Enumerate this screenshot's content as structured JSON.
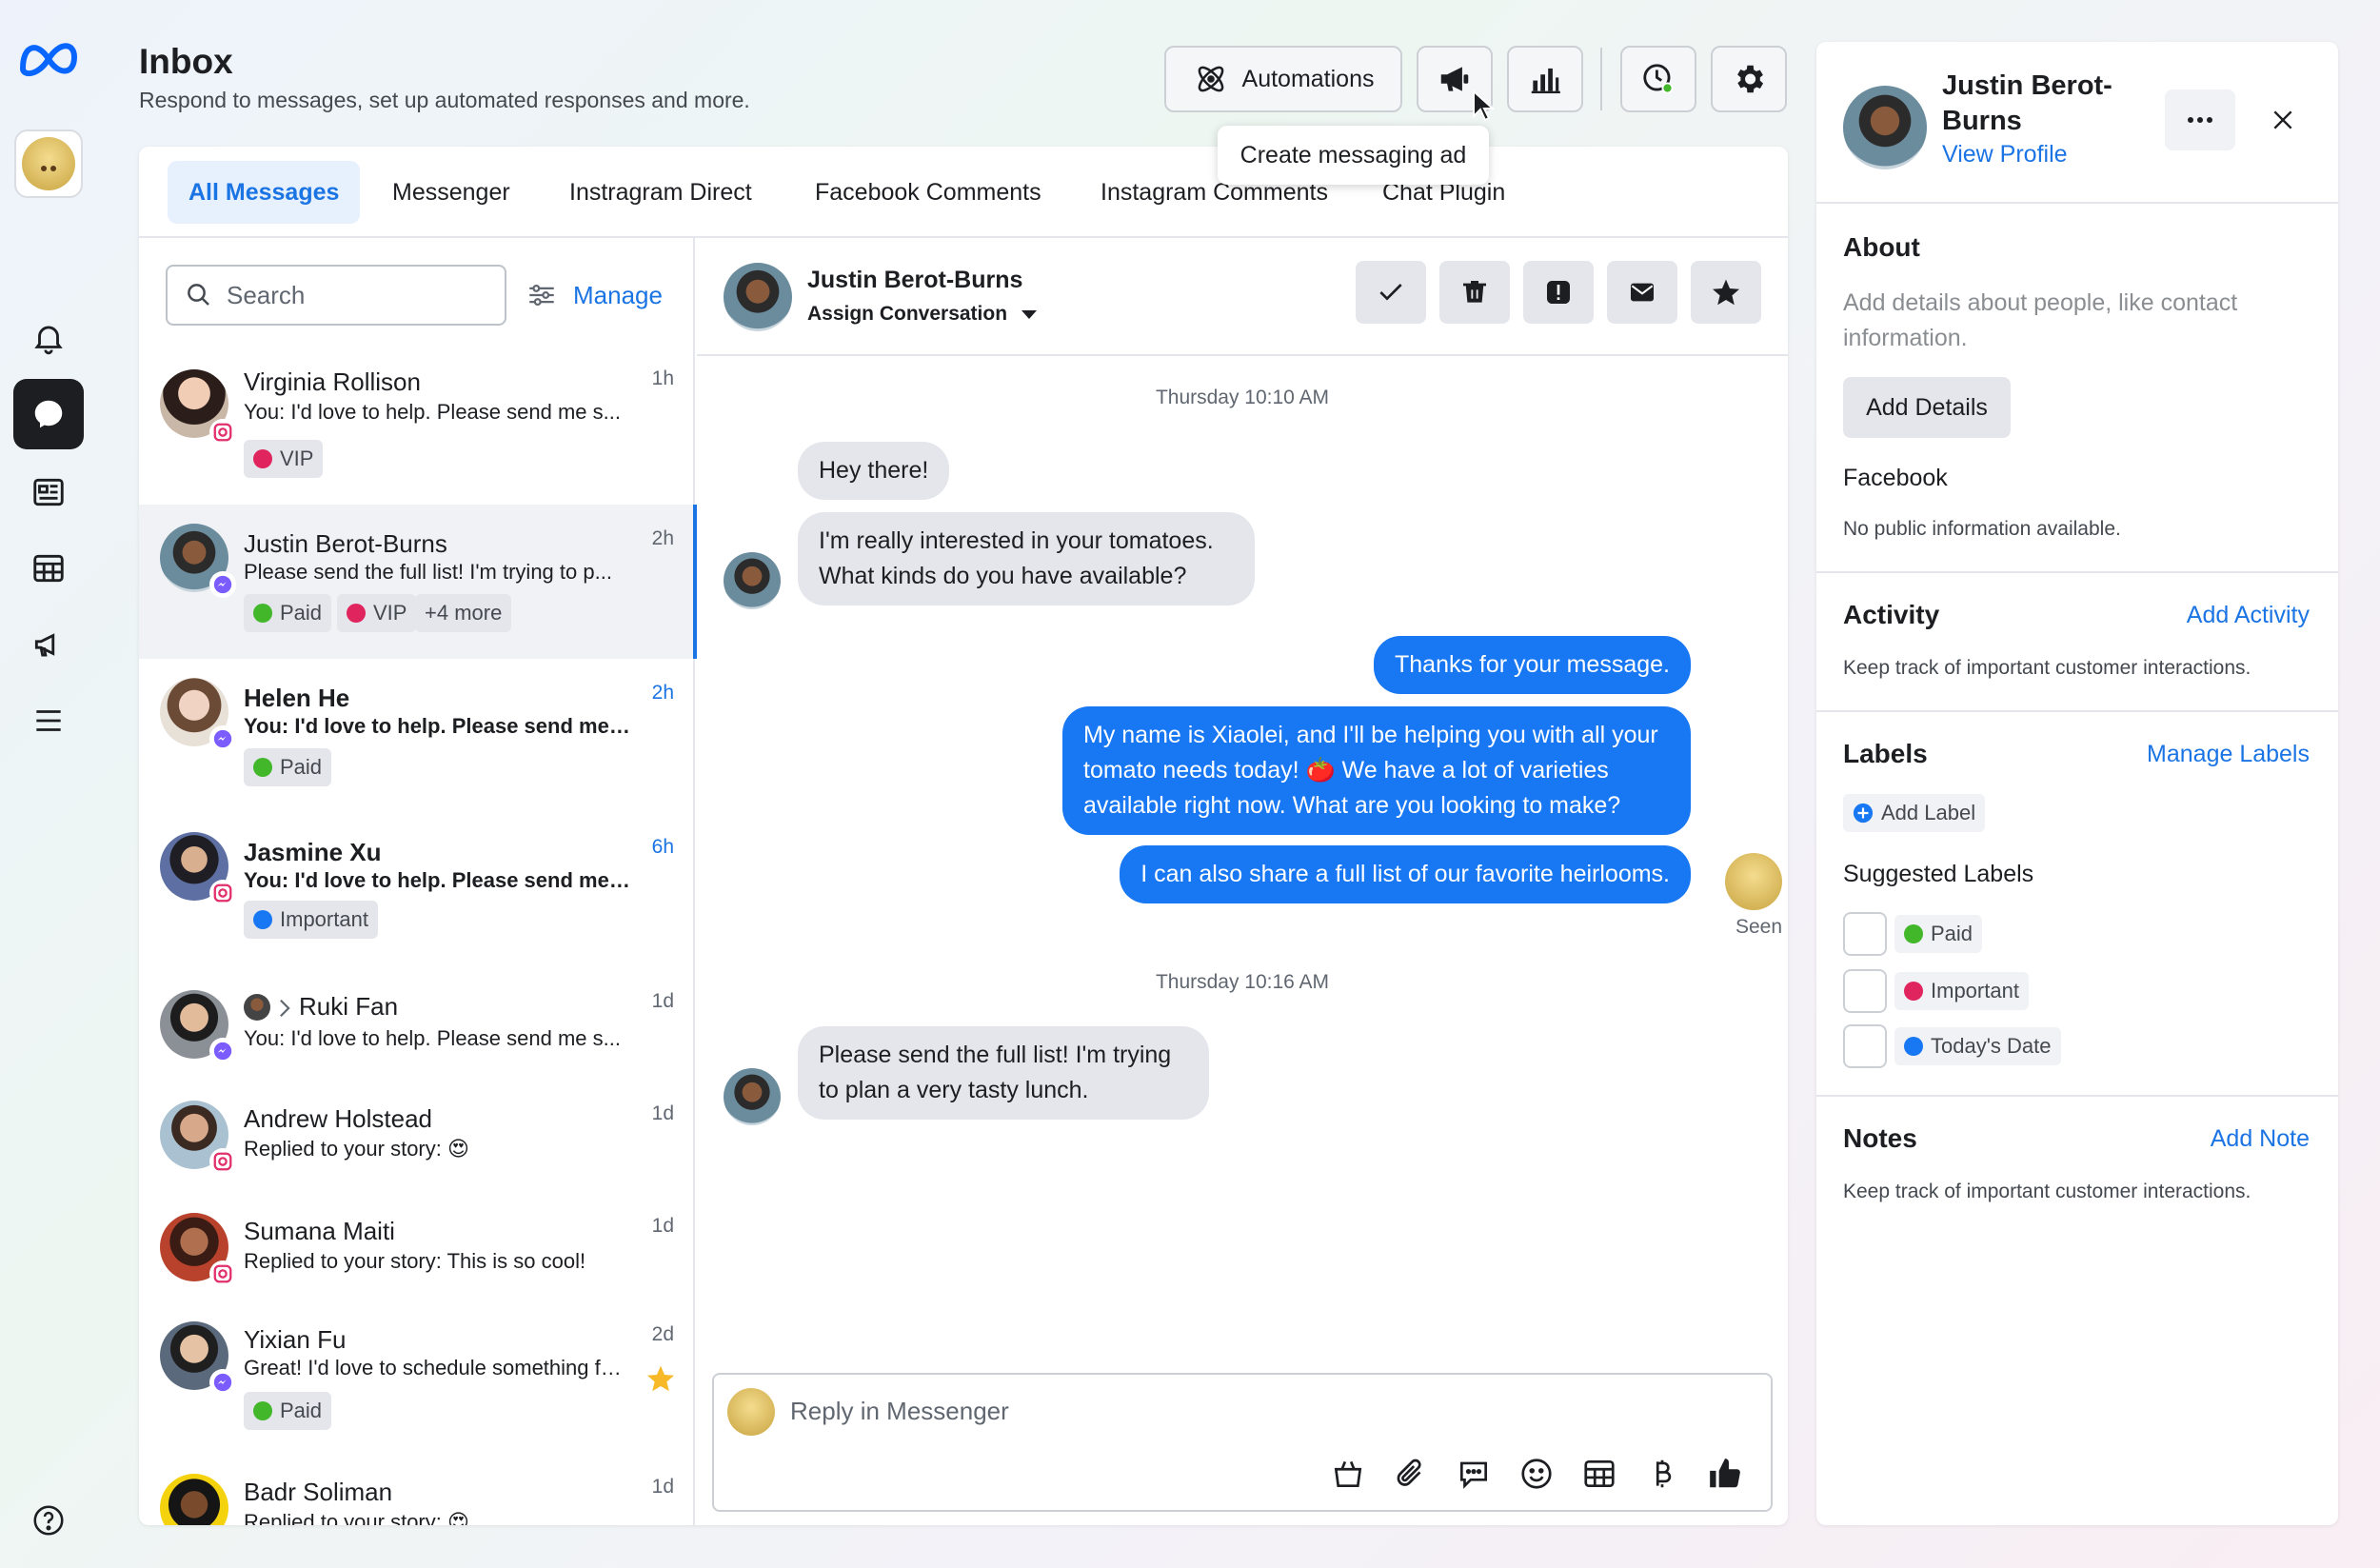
{
  "header": {
    "title": "Inbox",
    "subtitle": "Respond to messages, set up automated responses and more.",
    "automations_label": "Automations",
    "tooltip": "Create messaging ad"
  },
  "tabs": [
    "All Messages",
    "Messenger",
    "Instragram Direct",
    "Facebook Comments",
    "Instagram Comments",
    "Chat Plugin"
  ],
  "search": {
    "placeholder": "Search",
    "manage_label": "Manage"
  },
  "conversations": [
    {
      "name": "Virginia Rollison",
      "preview": "You: I'd love to help. Please send me s...",
      "time": "1h",
      "unread": false,
      "platform": "instagram",
      "labels": [
        {
          "text": "VIP",
          "color": "#e0245e"
        }
      ]
    },
    {
      "name": "Justin Berot-Burns",
      "preview": "Please send the full list! I'm trying to p...",
      "time": "2h",
      "unread": false,
      "platform": "messenger",
      "selected": true,
      "labels": [
        {
          "text": "Paid",
          "color": "#42b72a"
        },
        {
          "text": "VIP",
          "color": "#e0245e"
        }
      ],
      "more": "+4 more"
    },
    {
      "name": "Helen He",
      "preview": "You: I'd love to help. Please send me s...",
      "time": "2h",
      "unread": true,
      "platform": "messenger",
      "labels": [
        {
          "text": "Paid",
          "color": "#42b72a"
        }
      ]
    },
    {
      "name": "Jasmine Xu",
      "preview": "You: I'd love to help. Please send me s...",
      "time": "6h",
      "unread": true,
      "platform": "instagram",
      "labels": [
        {
          "text": "Important",
          "color": "#1877f2"
        }
      ]
    },
    {
      "name": "Ruki Fan",
      "preview": "You: I'd love to help. Please send me s...",
      "time": "1d",
      "unread": false,
      "platform": "messenger",
      "labels": []
    },
    {
      "name": "Andrew Holstead",
      "preview": "Replied to your story: 😍",
      "time": "1d",
      "unread": false,
      "platform": "instagram",
      "labels": []
    },
    {
      "name": "Sumana Maiti",
      "preview": "Replied to your story: This is so cool!",
      "time": "1d",
      "unread": false,
      "platform": "instagram",
      "labels": []
    },
    {
      "name": "Yixian Fu",
      "preview": "Great! I'd love to schedule something fo...",
      "time": "2d",
      "unread": false,
      "platform": "messenger",
      "starred": true,
      "labels": [
        {
          "text": "Paid",
          "color": "#42b72a"
        }
      ]
    },
    {
      "name": "Badr Soliman",
      "preview": "Replied to your story: 😍",
      "time": "1d",
      "unread": false,
      "platform": "instagram",
      "labels": []
    }
  ],
  "chat": {
    "contact_name": "Justin Berot-Burns",
    "assign_label": "Assign Conversation",
    "stamp1": "Thursday 10:10 AM",
    "stamp2": "Thursday 10:16 AM",
    "messages": [
      {
        "dir": "in",
        "text": "Hey there!"
      },
      {
        "dir": "in",
        "text": "I'm really interested in your tomatoes. What kinds do you have available?"
      },
      {
        "dir": "out",
        "text": "Thanks for your message."
      },
      {
        "dir": "out",
        "text": "My name is Xiaolei, and I'll be helping you with all your tomato needs today! 🍅 We have a lot of varieties available right now. What are you looking to make?"
      },
      {
        "dir": "out",
        "text": "I can also share a full list of our favorite heirlooms."
      },
      {
        "dir": "in",
        "text": "Please send the full list! I'm trying to plan a very tasty lunch."
      }
    ],
    "seen": "Seen",
    "reply_placeholder": "Reply in Messenger"
  },
  "details": {
    "name": "Justin Berot-Burns",
    "view_profile": "View Profile",
    "about_title": "About",
    "about_text": "Add details about people, like contact information.",
    "add_details": "Add Details",
    "facebook_title": "Facebook",
    "facebook_text": "No public information available.",
    "activity_title": "Activity",
    "add_activity": "Add Activity",
    "activity_text": "Keep track of important customer interactions.",
    "labels_title": "Labels",
    "manage_labels": "Manage Labels",
    "add_label": "Add Label",
    "suggested_title": "Suggested Labels",
    "suggested": [
      {
        "text": "Paid",
        "color": "#42b72a"
      },
      {
        "text": "Important",
        "color": "#e0245e"
      },
      {
        "text": "Today's Date",
        "color": "#1877f2"
      }
    ],
    "notes_title": "Notes",
    "add_note": "Add Note",
    "notes_text": "Keep track of important customer interactions."
  },
  "colors": {
    "accent": "#1877f2",
    "link": "#1b74e4"
  }
}
